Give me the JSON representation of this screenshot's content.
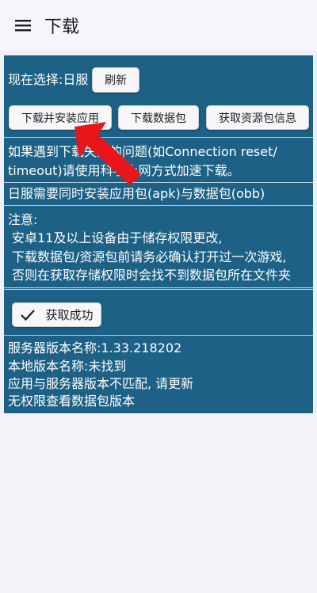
{
  "appbar": {
    "title": "下载"
  },
  "selection": {
    "label": "现在选择:日服",
    "refresh_button": "刷新"
  },
  "actions": {
    "download_install": "下载并安装应用",
    "download_data": "下载数据包",
    "get_info": "获取资源包信息"
  },
  "notices": {
    "connection_line1": "如果遇到下载失败的问题(如Connection reset/",
    "connection_line2": "timeout)请使用科学上网方式加速下载。",
    "jp_requirement": "日服需要同时安装应用包(apk)与数据包(obb)"
  },
  "note": {
    "heading": "注意:",
    "line1": "安卓11及以上设备由于储存权限更改,",
    "line2": "下载数据包/资源包前请务必确认打开过一次游戏,",
    "line3": "否则在获取存储权限时会找不到数据包所在文件夹"
  },
  "status_button": {
    "label": "获取成功",
    "icon": "check-icon"
  },
  "info": {
    "server_version": "服务器版本名称:1.33.218202",
    "local_version": "本地版本名称:未找到",
    "mismatch": "应用与服务器版本不匹配, 请更新",
    "no_permission": "无权限查看数据包版本"
  },
  "colors": {
    "panel": "#1d6186",
    "arrow": "#e8161b",
    "button_bg": "#f7f7f9"
  }
}
